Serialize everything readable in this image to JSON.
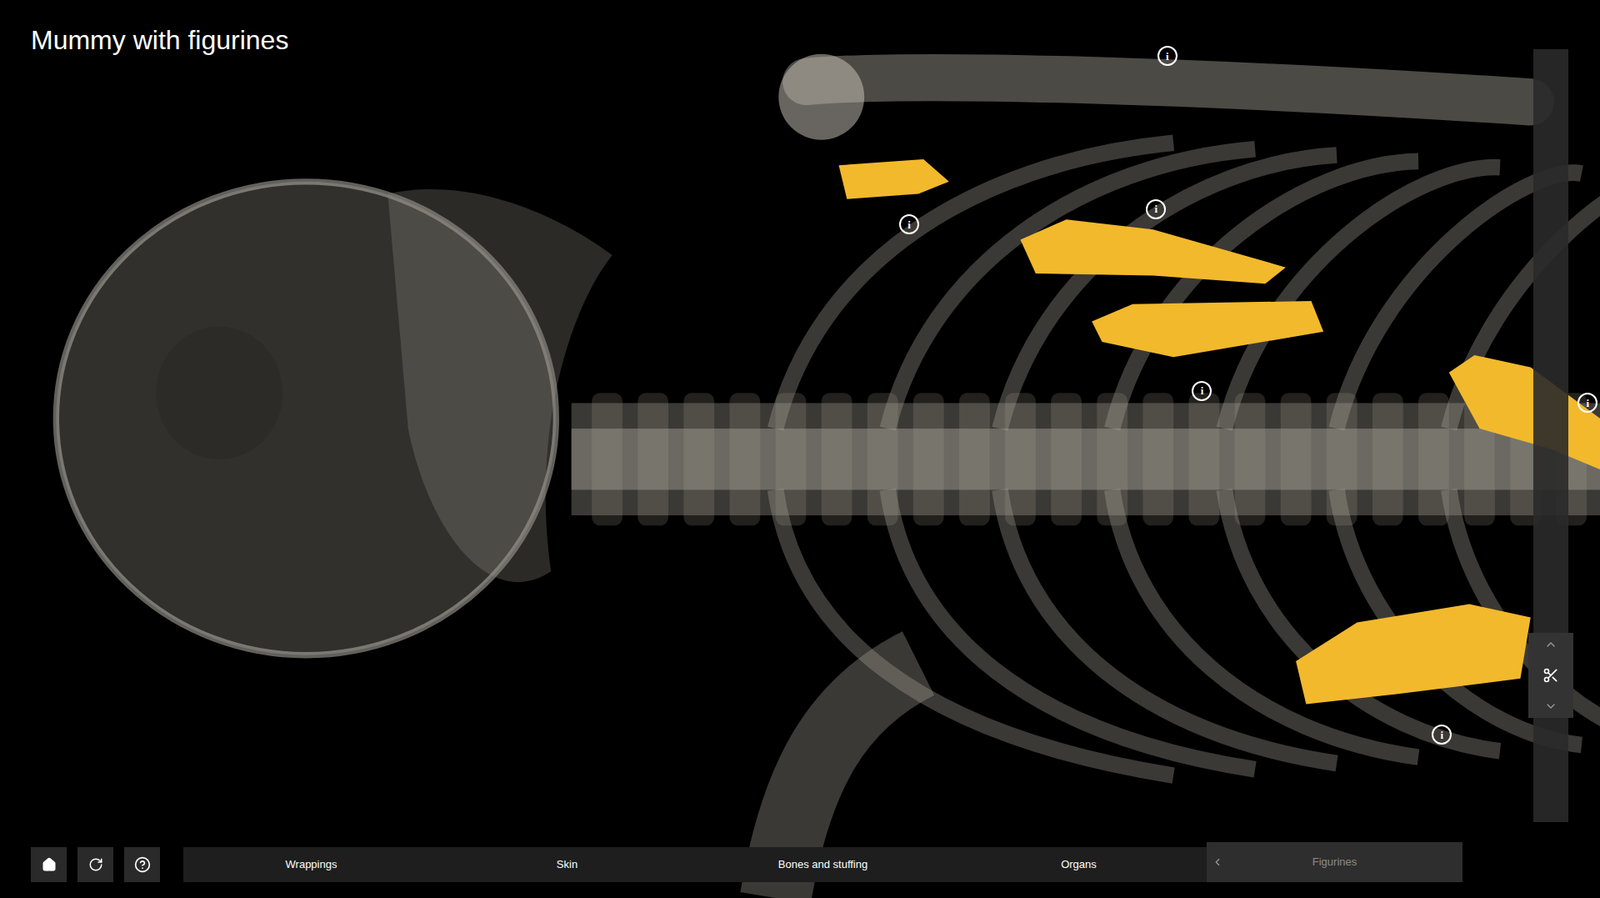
{
  "title": "Mummy with figurines",
  "info_markers": [
    {
      "label": "i"
    },
    {
      "label": "i"
    },
    {
      "label": "i"
    },
    {
      "label": "i"
    },
    {
      "label": "i"
    },
    {
      "label": "i"
    }
  ],
  "layers": [
    {
      "label": "Wrappings",
      "selected": false
    },
    {
      "label": "Skin",
      "selected": false
    },
    {
      "label": "Bones and stuffing",
      "selected": false
    },
    {
      "label": "Organs",
      "selected": false
    },
    {
      "label": "Figurines",
      "selected": true
    }
  ],
  "clip_slider": {
    "level": 0.81
  }
}
